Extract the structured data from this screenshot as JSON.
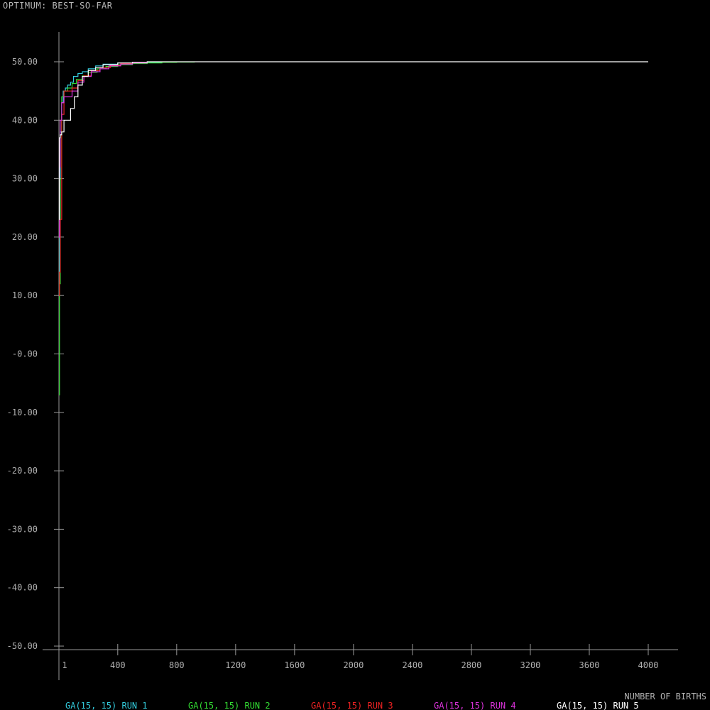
{
  "header": {
    "title": "OPTIMUM: BEST-SO-FAR"
  },
  "chart_data": {
    "type": "line",
    "title": "OPTIMUM: BEST-SO-FAR",
    "xlabel": "NUMBER OF BIRTHS",
    "ylabel": "",
    "xlim": [
      1,
      4000
    ],
    "ylim": [
      -50,
      50
    ],
    "x_ticks": [
      1,
      400,
      800,
      1200,
      1600,
      2000,
      2400,
      2800,
      3200,
      3600,
      4000
    ],
    "x_tick_labels": [
      "1",
      "400",
      "800",
      "1200",
      "1600",
      "2000",
      "2400",
      "2800",
      "3200",
      "3600",
      "4000"
    ],
    "y_ticks": [
      50,
      40,
      30,
      20,
      10,
      0,
      -10,
      -20,
      -30,
      -40,
      -50
    ],
    "y_tick_labels": [
      "50.00",
      "40.00",
      "30.00",
      "20.00",
      "10.00",
      "-0.00",
      "-10.00",
      "-20.00",
      "-30.00",
      "-40.00",
      "-50.00"
    ],
    "grid": false,
    "legend_position": "bottom",
    "series": [
      {
        "name": "GA(15, 15) RUN 1",
        "color": "#33ccdd",
        "x": [
          1,
          5,
          10,
          20,
          30,
          45,
          60,
          80,
          100,
          130,
          160,
          200,
          250,
          300,
          400,
          500,
          600,
          700
        ],
        "y": [
          10,
          25,
          38,
          43,
          45,
          45.5,
          46,
          46.5,
          47.5,
          48,
          48.3,
          48.8,
          49.3,
          49.6,
          49.8,
          49.9,
          49.95,
          50
        ]
      },
      {
        "name": "GA(15, 15) RUN 2",
        "color": "#33dd33",
        "x": [
          1,
          5,
          10,
          20,
          35,
          60,
          90,
          120,
          160,
          200,
          260,
          320,
          400,
          500,
          600,
          700,
          800,
          920
        ],
        "y": [
          -7,
          12,
          30,
          44,
          45,
          45.5,
          46.3,
          47,
          47.6,
          48.2,
          48.8,
          49.2,
          49.5,
          49.7,
          49.8,
          49.9,
          49.95,
          50
        ]
      },
      {
        "name": "GA(15, 15) RUN 3",
        "color": "#ee2222",
        "x": [
          1,
          5,
          10,
          20,
          35,
          60,
          90,
          130,
          170,
          220,
          280,
          350,
          420,
          500,
          600
        ],
        "y": [
          10,
          14,
          23,
          41,
          45,
          45,
          45.5,
          46.8,
          47.6,
          48.5,
          49,
          49.4,
          49.7,
          49.9,
          50
        ]
      },
      {
        "name": "GA(15, 15) RUN 4",
        "color": "#dd33dd",
        "x": [
          1,
          5,
          10,
          20,
          35,
          60,
          90,
          130,
          170,
          220,
          280,
          340,
          420,
          500,
          600
        ],
        "y": [
          20,
          32,
          40,
          43,
          44,
          44,
          45,
          46.5,
          47.5,
          48.3,
          48.8,
          49.3,
          49.6,
          49.8,
          50
        ]
      },
      {
        "name": "GA(15, 15) RUN 5",
        "color": "#ffffff",
        "x": [
          1,
          5,
          10,
          20,
          35,
          50,
          80,
          105,
          130,
          160,
          200,
          250,
          300,
          400,
          500,
          600,
          4000
        ],
        "y": [
          23,
          37,
          37.5,
          38,
          40,
          40,
          42,
          44,
          46,
          47.5,
          48.5,
          49,
          49.5,
          49.8,
          49.9,
          50,
          50
        ]
      }
    ]
  }
}
